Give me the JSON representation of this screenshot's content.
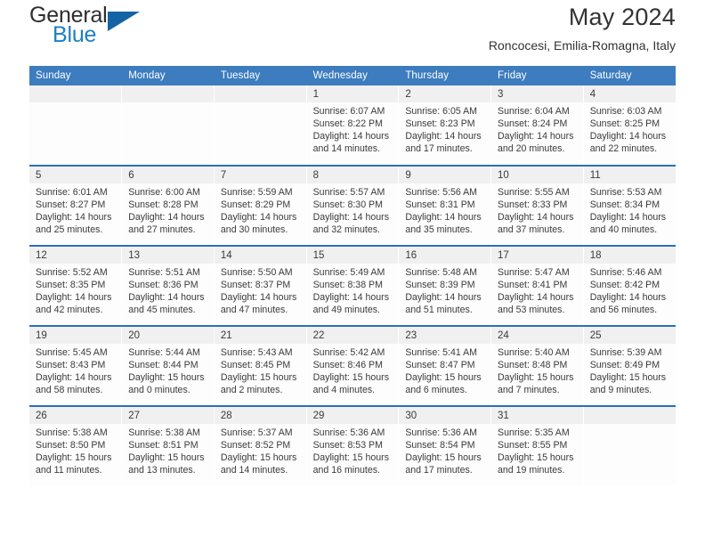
{
  "brand": {
    "name_top": "General",
    "name_bottom": "Blue",
    "triangle_color": "#1464a5",
    "blue_text_color": "#1c7fc4"
  },
  "header": {
    "title": "May 2024",
    "location": "Roncocesi, Emilia-Romagna, Italy"
  },
  "theme": {
    "header_bg": "#3c7cbf",
    "row_separator": "#2f6fb4",
    "daynum_band": "#f0f0f0",
    "text": "#3a3a3a"
  },
  "weekdays": [
    "Sunday",
    "Monday",
    "Tuesday",
    "Wednesday",
    "Thursday",
    "Friday",
    "Saturday"
  ],
  "labels": {
    "sunrise": "Sunrise:",
    "sunset": "Sunset:",
    "daylight": "Daylight:"
  },
  "weeks": [
    [
      {
        "day": ""
      },
      {
        "day": ""
      },
      {
        "day": ""
      },
      {
        "day": "1",
        "sunrise": "Sunrise: 6:07 AM",
        "sunset": "Sunset: 8:22 PM",
        "daylight1": "Daylight: 14 hours",
        "daylight2": "and 14 minutes."
      },
      {
        "day": "2",
        "sunrise": "Sunrise: 6:05 AM",
        "sunset": "Sunset: 8:23 PM",
        "daylight1": "Daylight: 14 hours",
        "daylight2": "and 17 minutes."
      },
      {
        "day": "3",
        "sunrise": "Sunrise: 6:04 AM",
        "sunset": "Sunset: 8:24 PM",
        "daylight1": "Daylight: 14 hours",
        "daylight2": "and 20 minutes."
      },
      {
        "day": "4",
        "sunrise": "Sunrise: 6:03 AM",
        "sunset": "Sunset: 8:25 PM",
        "daylight1": "Daylight: 14 hours",
        "daylight2": "and 22 minutes."
      }
    ],
    [
      {
        "day": "5",
        "sunrise": "Sunrise: 6:01 AM",
        "sunset": "Sunset: 8:27 PM",
        "daylight1": "Daylight: 14 hours",
        "daylight2": "and 25 minutes."
      },
      {
        "day": "6",
        "sunrise": "Sunrise: 6:00 AM",
        "sunset": "Sunset: 8:28 PM",
        "daylight1": "Daylight: 14 hours",
        "daylight2": "and 27 minutes."
      },
      {
        "day": "7",
        "sunrise": "Sunrise: 5:59 AM",
        "sunset": "Sunset: 8:29 PM",
        "daylight1": "Daylight: 14 hours",
        "daylight2": "and 30 minutes."
      },
      {
        "day": "8",
        "sunrise": "Sunrise: 5:57 AM",
        "sunset": "Sunset: 8:30 PM",
        "daylight1": "Daylight: 14 hours",
        "daylight2": "and 32 minutes."
      },
      {
        "day": "9",
        "sunrise": "Sunrise: 5:56 AM",
        "sunset": "Sunset: 8:31 PM",
        "daylight1": "Daylight: 14 hours",
        "daylight2": "and 35 minutes."
      },
      {
        "day": "10",
        "sunrise": "Sunrise: 5:55 AM",
        "sunset": "Sunset: 8:33 PM",
        "daylight1": "Daylight: 14 hours",
        "daylight2": "and 37 minutes."
      },
      {
        "day": "11",
        "sunrise": "Sunrise: 5:53 AM",
        "sunset": "Sunset: 8:34 PM",
        "daylight1": "Daylight: 14 hours",
        "daylight2": "and 40 minutes."
      }
    ],
    [
      {
        "day": "12",
        "sunrise": "Sunrise: 5:52 AM",
        "sunset": "Sunset: 8:35 PM",
        "daylight1": "Daylight: 14 hours",
        "daylight2": "and 42 minutes."
      },
      {
        "day": "13",
        "sunrise": "Sunrise: 5:51 AM",
        "sunset": "Sunset: 8:36 PM",
        "daylight1": "Daylight: 14 hours",
        "daylight2": "and 45 minutes."
      },
      {
        "day": "14",
        "sunrise": "Sunrise: 5:50 AM",
        "sunset": "Sunset: 8:37 PM",
        "daylight1": "Daylight: 14 hours",
        "daylight2": "and 47 minutes."
      },
      {
        "day": "15",
        "sunrise": "Sunrise: 5:49 AM",
        "sunset": "Sunset: 8:38 PM",
        "daylight1": "Daylight: 14 hours",
        "daylight2": "and 49 minutes."
      },
      {
        "day": "16",
        "sunrise": "Sunrise: 5:48 AM",
        "sunset": "Sunset: 8:39 PM",
        "daylight1": "Daylight: 14 hours",
        "daylight2": "and 51 minutes."
      },
      {
        "day": "17",
        "sunrise": "Sunrise: 5:47 AM",
        "sunset": "Sunset: 8:41 PM",
        "daylight1": "Daylight: 14 hours",
        "daylight2": "and 53 minutes."
      },
      {
        "day": "18",
        "sunrise": "Sunrise: 5:46 AM",
        "sunset": "Sunset: 8:42 PM",
        "daylight1": "Daylight: 14 hours",
        "daylight2": "and 56 minutes."
      }
    ],
    [
      {
        "day": "19",
        "sunrise": "Sunrise: 5:45 AM",
        "sunset": "Sunset: 8:43 PM",
        "daylight1": "Daylight: 14 hours",
        "daylight2": "and 58 minutes."
      },
      {
        "day": "20",
        "sunrise": "Sunrise: 5:44 AM",
        "sunset": "Sunset: 8:44 PM",
        "daylight1": "Daylight: 15 hours",
        "daylight2": "and 0 minutes."
      },
      {
        "day": "21",
        "sunrise": "Sunrise: 5:43 AM",
        "sunset": "Sunset: 8:45 PM",
        "daylight1": "Daylight: 15 hours",
        "daylight2": "and 2 minutes."
      },
      {
        "day": "22",
        "sunrise": "Sunrise: 5:42 AM",
        "sunset": "Sunset: 8:46 PM",
        "daylight1": "Daylight: 15 hours",
        "daylight2": "and 4 minutes."
      },
      {
        "day": "23",
        "sunrise": "Sunrise: 5:41 AM",
        "sunset": "Sunset: 8:47 PM",
        "daylight1": "Daylight: 15 hours",
        "daylight2": "and 6 minutes."
      },
      {
        "day": "24",
        "sunrise": "Sunrise: 5:40 AM",
        "sunset": "Sunset: 8:48 PM",
        "daylight1": "Daylight: 15 hours",
        "daylight2": "and 7 minutes."
      },
      {
        "day": "25",
        "sunrise": "Sunrise: 5:39 AM",
        "sunset": "Sunset: 8:49 PM",
        "daylight1": "Daylight: 15 hours",
        "daylight2": "and 9 minutes."
      }
    ],
    [
      {
        "day": "26",
        "sunrise": "Sunrise: 5:38 AM",
        "sunset": "Sunset: 8:50 PM",
        "daylight1": "Daylight: 15 hours",
        "daylight2": "and 11 minutes."
      },
      {
        "day": "27",
        "sunrise": "Sunrise: 5:38 AM",
        "sunset": "Sunset: 8:51 PM",
        "daylight1": "Daylight: 15 hours",
        "daylight2": "and 13 minutes."
      },
      {
        "day": "28",
        "sunrise": "Sunrise: 5:37 AM",
        "sunset": "Sunset: 8:52 PM",
        "daylight1": "Daylight: 15 hours",
        "daylight2": "and 14 minutes."
      },
      {
        "day": "29",
        "sunrise": "Sunrise: 5:36 AM",
        "sunset": "Sunset: 8:53 PM",
        "daylight1": "Daylight: 15 hours",
        "daylight2": "and 16 minutes."
      },
      {
        "day": "30",
        "sunrise": "Sunrise: 5:36 AM",
        "sunset": "Sunset: 8:54 PM",
        "daylight1": "Daylight: 15 hours",
        "daylight2": "and 17 minutes."
      },
      {
        "day": "31",
        "sunrise": "Sunrise: 5:35 AM",
        "sunset": "Sunset: 8:55 PM",
        "daylight1": "Daylight: 15 hours",
        "daylight2": "and 19 minutes."
      },
      {
        "day": ""
      }
    ]
  ]
}
